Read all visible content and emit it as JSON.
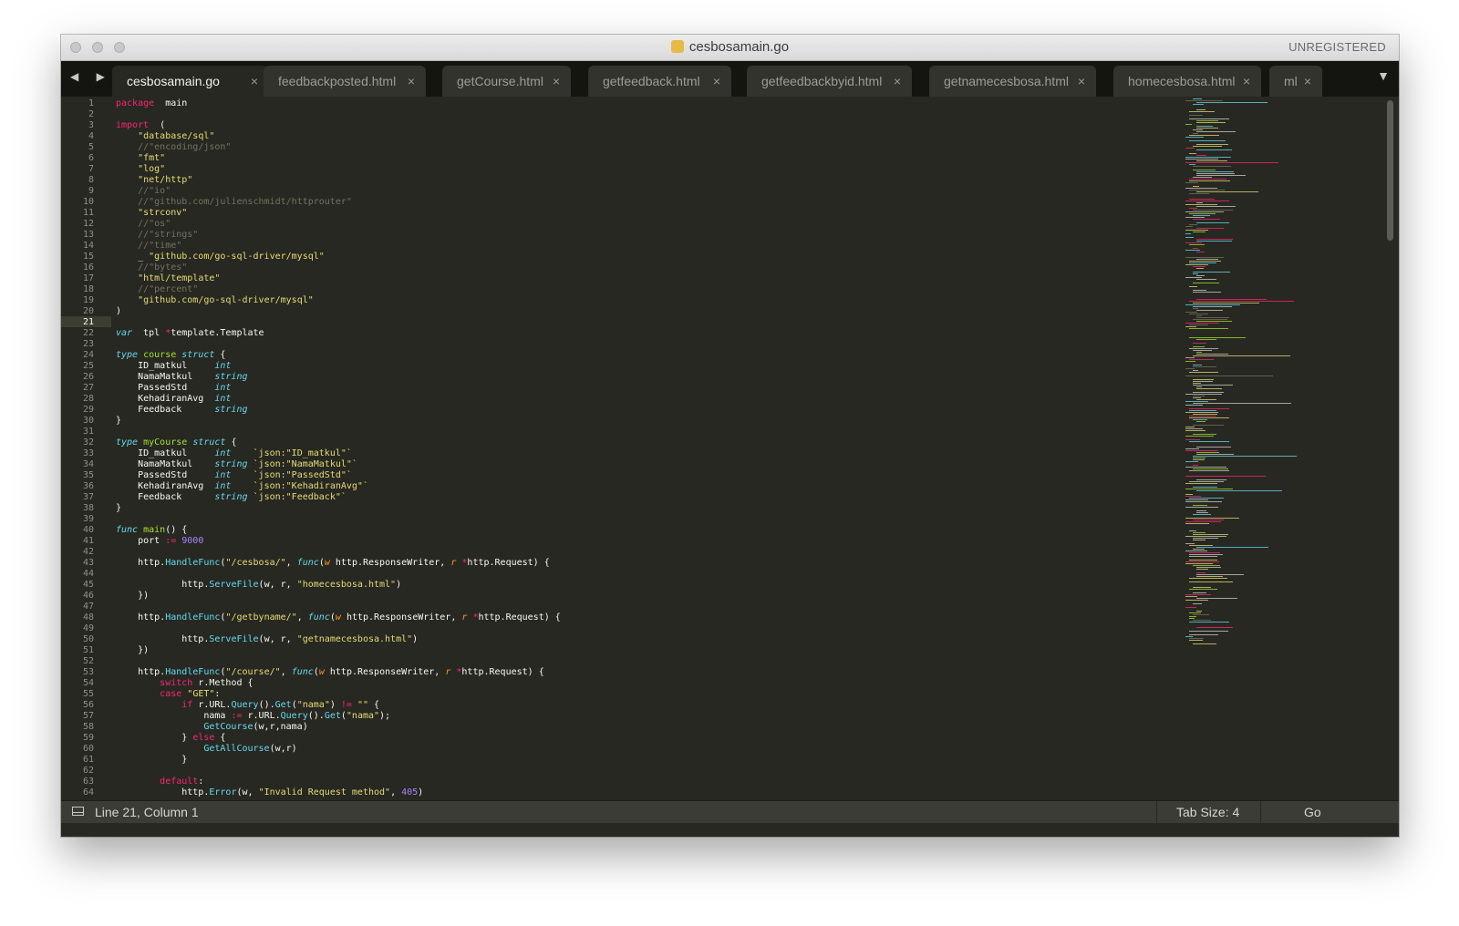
{
  "window": {
    "title": "cesbosamain.go",
    "registration": "UNREGISTERED",
    "traffic_lights": [
      "close-button",
      "minimize-button",
      "zoom-button"
    ]
  },
  "tabbar": {
    "nav": "◀ ▶",
    "menu_icon": "▼",
    "close_glyph": "×",
    "tabs": [
      {
        "label": "cesbosamain.go",
        "active": true
      },
      {
        "label": "feedbackposted.html",
        "active": false
      },
      {
        "label": "getCourse.html",
        "active": false
      },
      {
        "label": "getfeedback.html",
        "active": false
      },
      {
        "label": "getfeedbackbyid.html",
        "active": false
      },
      {
        "label": "getnamecesbosa.html",
        "active": false
      },
      {
        "label": "homecesbosa.html",
        "active": false
      },
      {
        "label": "ml",
        "active": false
      }
    ]
  },
  "editor": {
    "current_line": 21,
    "lines": [
      [
        [
          "kw",
          "package"
        ],
        [
          "",
          "  main"
        ]
      ],
      [],
      [
        [
          "kw",
          "import"
        ],
        [
          "",
          "  ("
        ]
      ],
      [
        [
          "",
          "    "
        ],
        [
          "st",
          "\"database/sql\""
        ]
      ],
      [
        [
          "",
          "    "
        ],
        [
          "cm",
          "//\"encoding/json\""
        ]
      ],
      [
        [
          "",
          "    "
        ],
        [
          "st",
          "\"fmt\""
        ]
      ],
      [
        [
          "",
          "    "
        ],
        [
          "st",
          "\"log\""
        ]
      ],
      [
        [
          "",
          "    "
        ],
        [
          "st",
          "\"net/http\""
        ]
      ],
      [
        [
          "",
          "    "
        ],
        [
          "cm",
          "//\"io\""
        ]
      ],
      [
        [
          "",
          "    "
        ],
        [
          "cm",
          "//\"github.com/julienschmidt/httprouter\""
        ]
      ],
      [
        [
          "",
          "    "
        ],
        [
          "st",
          "\"strconv\""
        ]
      ],
      [
        [
          "",
          "    "
        ],
        [
          "cm",
          "//\"os\""
        ]
      ],
      [
        [
          "",
          "    "
        ],
        [
          "cm",
          "//\"strings\""
        ]
      ],
      [
        [
          "",
          "    "
        ],
        [
          "cm",
          "//\"time\""
        ]
      ],
      [
        [
          "",
          "    _ "
        ],
        [
          "st",
          "\"github.com/go-sql-driver/mysql\""
        ]
      ],
      [
        [
          "",
          "    "
        ],
        [
          "cm",
          "//\"bytes\""
        ]
      ],
      [
        [
          "",
          "    "
        ],
        [
          "st",
          "\"html/template\""
        ]
      ],
      [
        [
          "",
          "    "
        ],
        [
          "cm",
          "//\"percent\""
        ]
      ],
      [
        [
          "",
          "    "
        ],
        [
          "st",
          "\"github.com/go-sql-driver/mysql\""
        ]
      ],
      [
        [
          "",
          ")"
        ]
      ],
      [],
      [
        [
          "ty",
          "var"
        ],
        [
          "",
          "  tpl "
        ],
        [
          "kw",
          "*"
        ],
        [
          "",
          "template.Template"
        ]
      ],
      [],
      [
        [
          "ty",
          "type"
        ],
        [
          "",
          " "
        ],
        [
          "fn",
          "course"
        ],
        [
          "",
          " "
        ],
        [
          "ty",
          "struct"
        ],
        [
          "",
          " {"
        ]
      ],
      [
        [
          "",
          "    ID_matkul     "
        ],
        [
          "ty",
          "int"
        ]
      ],
      [
        [
          "",
          "    NamaMatkul    "
        ],
        [
          "ty",
          "string"
        ]
      ],
      [
        [
          "",
          "    PassedStd     "
        ],
        [
          "ty",
          "int"
        ]
      ],
      [
        [
          "",
          "    KehadiranAvg  "
        ],
        [
          "ty",
          "int"
        ]
      ],
      [
        [
          "",
          "    Feedback      "
        ],
        [
          "ty",
          "string"
        ]
      ],
      [
        [
          "",
          "}"
        ]
      ],
      [],
      [
        [
          "ty",
          "type"
        ],
        [
          "",
          " "
        ],
        [
          "fn",
          "myCourse"
        ],
        [
          "",
          " "
        ],
        [
          "ty",
          "struct"
        ],
        [
          "",
          " {"
        ]
      ],
      [
        [
          "",
          "    ID_matkul     "
        ],
        [
          "ty",
          "int"
        ],
        [
          "",
          "    "
        ],
        [
          "st",
          "`json:\"ID_matkul\"`"
        ]
      ],
      [
        [
          "",
          "    NamaMatkul    "
        ],
        [
          "ty",
          "string"
        ],
        [
          "",
          " "
        ],
        [
          "st",
          "`json:\"NamaMatkul\"`"
        ]
      ],
      [
        [
          "",
          "    PassedStd     "
        ],
        [
          "ty",
          "int"
        ],
        [
          "",
          "    "
        ],
        [
          "st",
          "`json:\"PassedStd\"`"
        ]
      ],
      [
        [
          "",
          "    KehadiranAvg  "
        ],
        [
          "ty",
          "int"
        ],
        [
          "",
          "    "
        ],
        [
          "st",
          "`json:\"KehadiranAvg\"`"
        ]
      ],
      [
        [
          "",
          "    Feedback      "
        ],
        [
          "ty",
          "string"
        ],
        [
          "",
          " "
        ],
        [
          "st",
          "`json:\"Feedback\"`"
        ]
      ],
      [
        [
          "",
          "}"
        ]
      ],
      [],
      [
        [
          "ty",
          "func"
        ],
        [
          "",
          " "
        ],
        [
          "fn",
          "main"
        ],
        [
          "",
          "() {"
        ]
      ],
      [
        [
          "",
          "    port "
        ],
        [
          "kw",
          ":="
        ],
        [
          "",
          " "
        ],
        [
          "nm",
          "9000"
        ]
      ],
      [],
      [
        [
          "",
          "    http."
        ],
        [
          "bi",
          "HandleFunc"
        ],
        [
          "",
          "("
        ],
        [
          "st",
          "\"/cesbosa/\""
        ],
        [
          "",
          ", "
        ],
        [
          "ty",
          "func"
        ],
        [
          "",
          "("
        ],
        [
          "pm",
          "w"
        ],
        [
          "",
          " http.ResponseWriter, "
        ],
        [
          "pm",
          "r"
        ],
        [
          "",
          " "
        ],
        [
          "kw",
          "*"
        ],
        [
          "",
          "http.Request) {"
        ]
      ],
      [],
      [
        [
          "",
          "            http."
        ],
        [
          "bi",
          "ServeFile"
        ],
        [
          "",
          "(w, r, "
        ],
        [
          "st",
          "\"homecesbosa.html\""
        ],
        [
          "",
          ")"
        ]
      ],
      [
        [
          "",
          "    })"
        ]
      ],
      [],
      [
        [
          "",
          "    http."
        ],
        [
          "bi",
          "HandleFunc"
        ],
        [
          "",
          "("
        ],
        [
          "st",
          "\"/getbyname/\""
        ],
        [
          "",
          ", "
        ],
        [
          "ty",
          "func"
        ],
        [
          "",
          "("
        ],
        [
          "pm",
          "w"
        ],
        [
          "",
          " http.ResponseWriter, "
        ],
        [
          "pm",
          "r"
        ],
        [
          "",
          " "
        ],
        [
          "kw",
          "*"
        ],
        [
          "",
          "http.Request) {"
        ]
      ],
      [],
      [
        [
          "",
          "            http."
        ],
        [
          "bi",
          "ServeFile"
        ],
        [
          "",
          "(w, r, "
        ],
        [
          "st",
          "\"getnamecesbosa.html\""
        ],
        [
          "",
          ")"
        ]
      ],
      [
        [
          "",
          "    })"
        ]
      ],
      [],
      [
        [
          "",
          "    http."
        ],
        [
          "bi",
          "HandleFunc"
        ],
        [
          "",
          "("
        ],
        [
          "st",
          "\"/course/\""
        ],
        [
          "",
          ", "
        ],
        [
          "ty",
          "func"
        ],
        [
          "",
          "("
        ],
        [
          "pm",
          "w"
        ],
        [
          "",
          " http.ResponseWriter, "
        ],
        [
          "pm",
          "r"
        ],
        [
          "",
          " "
        ],
        [
          "kw",
          "*"
        ],
        [
          "",
          "http.Request) {"
        ]
      ],
      [
        [
          "",
          "        "
        ],
        [
          "kw",
          "switch"
        ],
        [
          "",
          " r.Method {"
        ]
      ],
      [
        [
          "",
          "        "
        ],
        [
          "kw",
          "case"
        ],
        [
          "",
          " "
        ],
        [
          "st",
          "\"GET\""
        ],
        [
          "",
          ":"
        ]
      ],
      [
        [
          "",
          "            "
        ],
        [
          "kw",
          "if"
        ],
        [
          "",
          " r.URL."
        ],
        [
          "bi",
          "Query"
        ],
        [
          "",
          "()."
        ],
        [
          "bi",
          "Get"
        ],
        [
          "",
          "("
        ],
        [
          "st",
          "\"nama\""
        ],
        [
          "",
          ") "
        ],
        [
          "kw",
          "!="
        ],
        [
          "",
          " "
        ],
        [
          "st",
          "\"\""
        ],
        [
          "",
          " {"
        ]
      ],
      [
        [
          "",
          "                nama "
        ],
        [
          "kw",
          ":="
        ],
        [
          "",
          " r.URL."
        ],
        [
          "bi",
          "Query"
        ],
        [
          "",
          "()."
        ],
        [
          "bi",
          "Get"
        ],
        [
          "",
          "("
        ],
        [
          "st",
          "\"nama\""
        ],
        [
          "",
          ");"
        ]
      ],
      [
        [
          "",
          "                "
        ],
        [
          "bi",
          "GetCourse"
        ],
        [
          "",
          "(w,r,nama)"
        ]
      ],
      [
        [
          "",
          "            } "
        ],
        [
          "kw",
          "else"
        ],
        [
          "",
          " {"
        ]
      ],
      [
        [
          "",
          "                "
        ],
        [
          "bi",
          "GetAllCourse"
        ],
        [
          "",
          "(w,r)"
        ]
      ],
      [
        [
          "",
          "            }"
        ]
      ],
      [],
      [
        [
          "",
          "        "
        ],
        [
          "kw",
          "default"
        ],
        [
          "",
          ":"
        ]
      ],
      [
        [
          "",
          "            http."
        ],
        [
          "bi",
          "Error"
        ],
        [
          "",
          "(w, "
        ],
        [
          "st",
          "\"Invalid Request method\""
        ],
        [
          "",
          ", "
        ],
        [
          "nm",
          "405"
        ],
        [
          "",
          ")"
        ]
      ]
    ]
  },
  "statusbar": {
    "position": "Line 21, Column 1",
    "tab_size": "Tab Size: 4",
    "syntax": "Go"
  },
  "colors": {
    "background": "#272822",
    "keyword": "#f92672",
    "string": "#e6db74",
    "comment": "#75715e",
    "type": "#66d9ef",
    "function": "#a6e22e",
    "number": "#ae81ff",
    "param": "#fd971f"
  }
}
